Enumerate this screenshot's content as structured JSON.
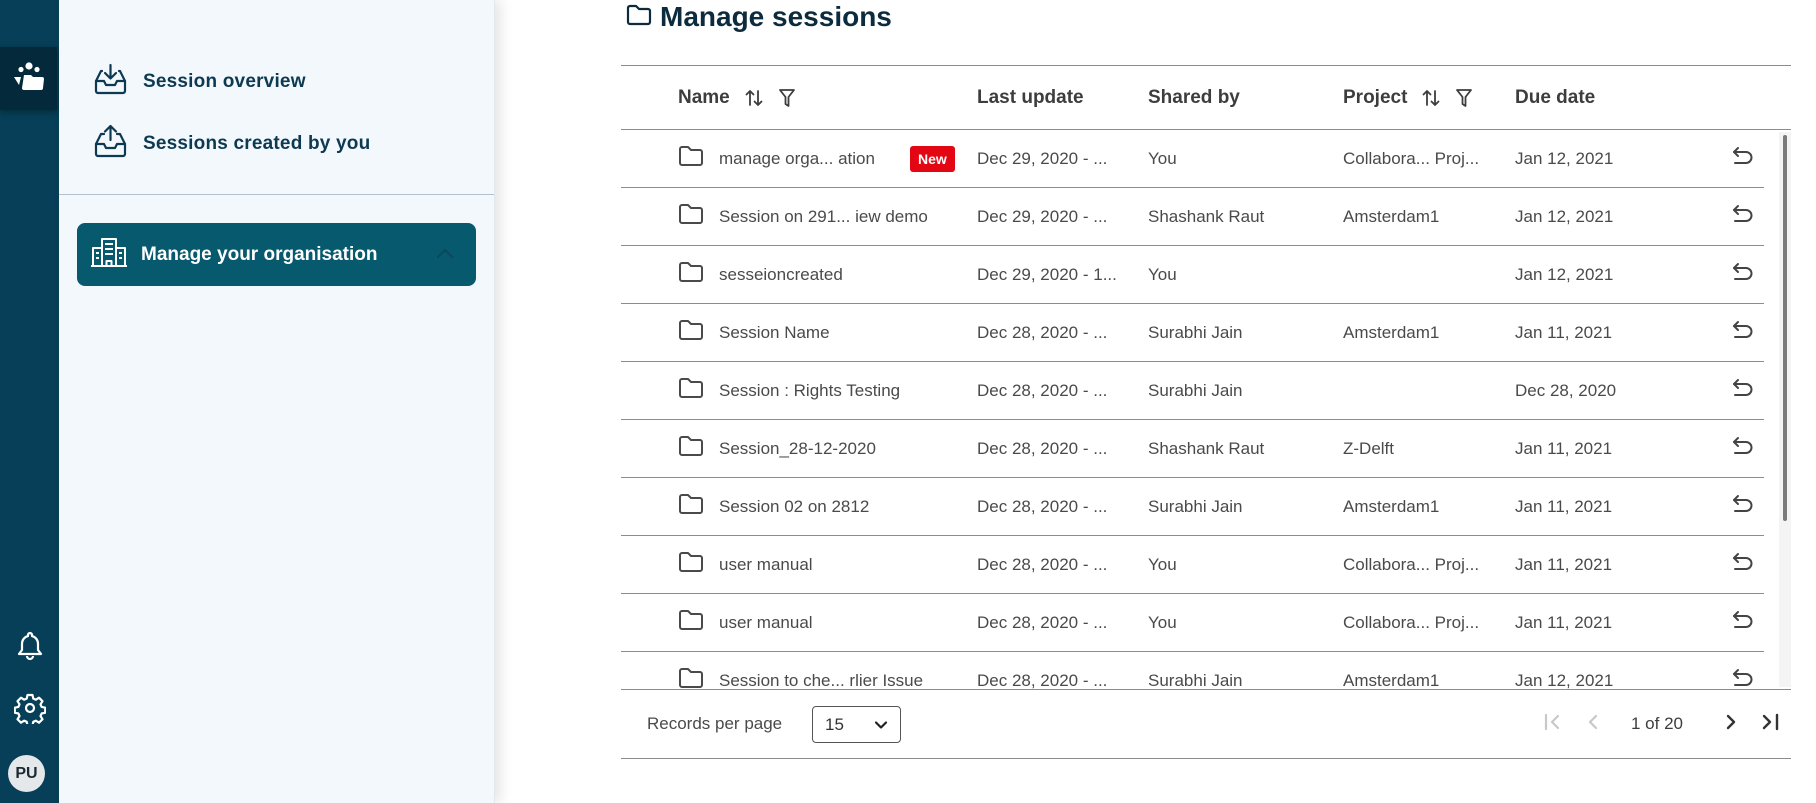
{
  "rail": {
    "active_icon": "collaboration-sessions-icon",
    "bottom_icons": [
      "bell-icon",
      "gear-icon"
    ],
    "avatar_initials": "PU"
  },
  "panel": {
    "items": [
      {
        "label": "Session overview",
        "icon": "inbox-download-icon"
      },
      {
        "label": "Sessions created by you",
        "icon": "inbox-upload-icon"
      }
    ],
    "org_button": {
      "label": "Manage your organisation",
      "icon": "building-icon",
      "expanded": true
    }
  },
  "main": {
    "title": "Manage sessions",
    "table": {
      "columns": [
        {
          "label": "Name",
          "sortable": true,
          "filterable": true
        },
        {
          "label": "Last update",
          "sortable": false,
          "filterable": false
        },
        {
          "label": "Shared by",
          "sortable": false,
          "filterable": false
        },
        {
          "label": "Project",
          "sortable": true,
          "filterable": true
        },
        {
          "label": "Due date",
          "sortable": false,
          "filterable": false
        }
      ],
      "rows": [
        {
          "name": "manage orga... ation",
          "badge": "New",
          "last_update": "Dec 29, 2020 - ...",
          "shared_by": "You",
          "project": "Collabora... Proj...",
          "due_date": "Jan 12, 2021"
        },
        {
          "name": "Session on 291... iew demo",
          "badge": "",
          "last_update": "Dec 29, 2020 - ...",
          "shared_by": "Shashank Raut",
          "project": "Amsterdam1",
          "due_date": "Jan 12, 2021"
        },
        {
          "name": "sesseioncreated",
          "badge": "",
          "last_update": "Dec 29, 2020 - 1...",
          "shared_by": "You",
          "project": "",
          "due_date": "Jan 12, 2021"
        },
        {
          "name": "Session Name",
          "badge": "",
          "last_update": "Dec 28, 2020 - ...",
          "shared_by": "Surabhi Jain",
          "project": "Amsterdam1",
          "due_date": "Jan 11, 2021"
        },
        {
          "name": "Session : Rights Testing",
          "badge": "",
          "last_update": "Dec 28, 2020 - ...",
          "shared_by": "Surabhi Jain",
          "project": "",
          "due_date": "Dec 28, 2020"
        },
        {
          "name": "Session_28-12-2020",
          "badge": "",
          "last_update": "Dec 28, 2020 - ...",
          "shared_by": "Shashank Raut",
          "project": "Z-Delft",
          "due_date": "Jan 11, 2021"
        },
        {
          "name": "Session 02 on 2812",
          "badge": "",
          "last_update": "Dec 28, 2020 - ...",
          "shared_by": "Surabhi Jain",
          "project": "Amsterdam1",
          "due_date": "Jan 11, 2021"
        },
        {
          "name": "user manual",
          "badge": "",
          "last_update": "Dec 28, 2020 - ...",
          "shared_by": "You",
          "project": "Collabora... Proj...",
          "due_date": "Jan 11, 2021"
        },
        {
          "name": "user manual",
          "badge": "",
          "last_update": "Dec 28, 2020 - ...",
          "shared_by": "You",
          "project": "Collabora... Proj...",
          "due_date": "Jan 11, 2021"
        },
        {
          "name": "Session to che... rlier Issue",
          "badge": "",
          "last_update": "Dec 28, 2020 - ...",
          "shared_by": "Surabhi Jain",
          "project": "Amsterdam1",
          "due_date": "Jan 12, 2021"
        }
      ],
      "row_action_icon": "undo-icon"
    },
    "footer": {
      "records_label": "Records per page",
      "records_value": "15",
      "page_text": "1 of 20",
      "first_enabled": false,
      "prev_enabled": false,
      "next_enabled": true,
      "last_enabled": true
    }
  },
  "colors": {
    "rail_bg": "#063f57",
    "rail_active_bg": "#03293b",
    "accent": "#075a6e",
    "badge_new": "#e30613",
    "panel_bg": "#f3f8fc",
    "title_text": "#0d2b3e"
  }
}
